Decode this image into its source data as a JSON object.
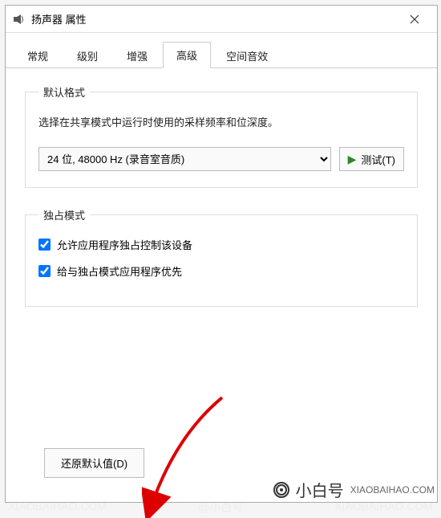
{
  "window": {
    "title": "扬声器 属性",
    "close_icon": "close-icon"
  },
  "tabs": [
    {
      "label": "常规"
    },
    {
      "label": "级别"
    },
    {
      "label": "增强"
    },
    {
      "label": "高级"
    },
    {
      "label": "空间音效"
    }
  ],
  "default_format": {
    "legend": "默认格式",
    "description": "选择在共享模式中运行时使用的采样频率和位深度。",
    "selected": "24 位, 48000 Hz (录音室音质)",
    "test_button": "测试(T)"
  },
  "exclusive": {
    "legend": "独占模式",
    "opt1": "允许应用程序独占控制该设备",
    "opt2": "给与独占模式应用程序优先"
  },
  "reset_button": "还原默认值(D)",
  "watermark": {
    "a": "@小白号",
    "b": "XIAOBAIHAO.COM"
  },
  "brand": {
    "name": "小白号",
    "url": "XIAOBAIHAO.COM"
  }
}
